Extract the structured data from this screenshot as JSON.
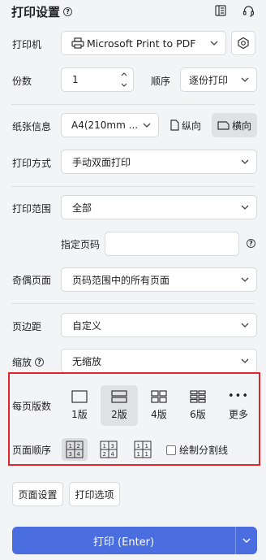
{
  "header": {
    "title": "打印设置",
    "help_icon": "?",
    "icons": [
      "layout-icon",
      "headset-icon"
    ]
  },
  "printer": {
    "label": "打印机",
    "value": "Microsoft Print to PDF",
    "settings_icon": "hexagon-settings-icon"
  },
  "copies": {
    "label": "份数",
    "value": "1",
    "order_label": "顺序",
    "order_value": "逐份打印"
  },
  "paper": {
    "label": "纸张信息",
    "value": "A4(210mm ...",
    "portrait": "纵向",
    "landscape": "横向"
  },
  "print_mode": {
    "label": "打印方式",
    "value": "手动双面打印"
  },
  "print_range": {
    "label": "打印范围",
    "value": "全部",
    "pages_label": "指定页码",
    "pages_value": ""
  },
  "odd_even": {
    "label": "奇偶页面",
    "value": "页码范围中的所有页面"
  },
  "margin": {
    "label": "页边距",
    "value": "自定义"
  },
  "zoom": {
    "label": "缩放",
    "value": "无缩放"
  },
  "per_page": {
    "label": "每页版数",
    "options": [
      {
        "label": "1版",
        "selected": false
      },
      {
        "label": "2版",
        "selected": true
      },
      {
        "label": "4版",
        "selected": false
      },
      {
        "label": "6版",
        "selected": false
      },
      {
        "label": "更多",
        "selected": false
      }
    ]
  },
  "page_order": {
    "label": "页面顺序",
    "icons": [
      {
        "digits": [
          "1",
          "2",
          "3",
          "4"
        ],
        "selected": true
      },
      {
        "digits": [
          "1",
          "3",
          "2",
          "4"
        ],
        "selected": false
      },
      {
        "digits": [
          "1",
          "1",
          "1",
          "1"
        ],
        "selected": false
      }
    ],
    "draw_lines_label": "绘制分割线",
    "draw_lines_checked": false
  },
  "buttons": {
    "page_setup": "页面设置",
    "print_options": "打印选项",
    "print": "打印 (Enter)"
  },
  "colors": {
    "accent": "#4a6ee0",
    "highlight": "#e0262b"
  }
}
